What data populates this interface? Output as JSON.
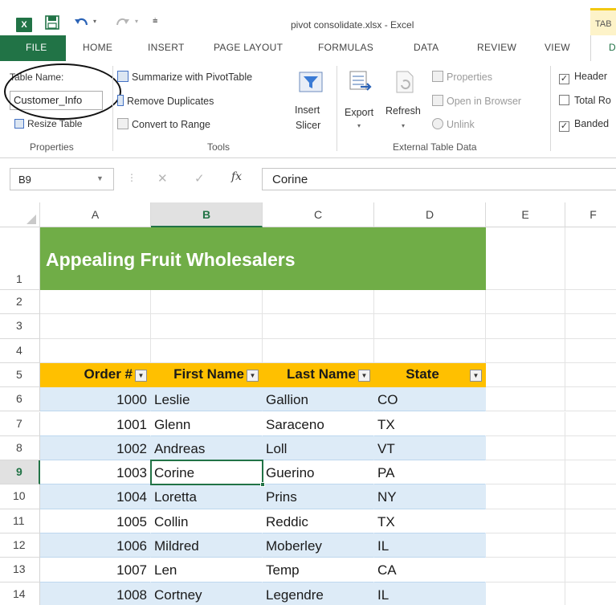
{
  "window": {
    "title": "pivot consolidate.xlsx - Excel",
    "context_tab_group": "TAB",
    "app_icon": "excel-logo"
  },
  "qat": {
    "save_icon": "save-icon",
    "undo_icon": "undo-icon",
    "redo_icon": "redo-icon",
    "customize_icon": "customize-qat-icon"
  },
  "tabs": {
    "file": "FILE",
    "home": "HOME",
    "insert": "INSERT",
    "page_layout": "PAGE LAYOUT",
    "formulas": "FORMULAS",
    "data": "DATA",
    "review": "REVIEW",
    "view": "VIEW",
    "design": "D"
  },
  "ribbon": {
    "properties": {
      "table_name_label": "Table Name:",
      "table_name_value": "Customer_Info",
      "resize_table": "Resize Table",
      "group_label": "Properties"
    },
    "tools": {
      "summarize_pivot": "Summarize with PivotTable",
      "remove_duplicates": "Remove Duplicates",
      "convert_to_range": "Convert to Range",
      "insert_slicer_line1": "Insert",
      "insert_slicer_line2": "Slicer",
      "group_label": "Tools"
    },
    "external": {
      "export": "Export",
      "refresh": "Refresh",
      "properties": "Properties",
      "open_in_browser": "Open in Browser",
      "unlink": "Unlink",
      "group_label": "External Table Data"
    },
    "style_options": {
      "header_row": "Header",
      "header_row_checked": true,
      "total_row": "Total Ro",
      "total_row_checked": false,
      "banded_rows": "Banded",
      "banded_rows_checked": true
    }
  },
  "formula_bar": {
    "name_box": "B9",
    "cancel_icon": "✕",
    "enter_icon": "✓",
    "fx_label": "fx",
    "content": "Corine"
  },
  "grid": {
    "column_headers": [
      "A",
      "B",
      "C",
      "D",
      "E",
      "F"
    ],
    "selected_column": "B",
    "row_headers": [
      "1",
      "2",
      "3",
      "4",
      "5",
      "6",
      "7",
      "8",
      "9",
      "10",
      "11",
      "12",
      "13",
      "14"
    ],
    "selected_row": "9",
    "sheet_title": "Appealing Fruit Wholesalers",
    "table_headers": [
      "Order #",
      "First Name",
      "Last Name",
      "State"
    ],
    "rows": [
      [
        "1000",
        "Leslie",
        "Gallion",
        "CO"
      ],
      [
        "1001",
        "Glenn",
        "Saraceno",
        "TX"
      ],
      [
        "1002",
        "Andreas",
        "Loll",
        "VT"
      ],
      [
        "1003",
        "Corine",
        "Guerino",
        "PA"
      ],
      [
        "1004",
        "Loretta",
        "Prins",
        "NY"
      ],
      [
        "1005",
        "Collin",
        "Reddic",
        "TX"
      ],
      [
        "1006",
        "Mildred",
        "Moberley",
        "IL"
      ],
      [
        "1007",
        "Len",
        "Temp",
        "CA"
      ],
      [
        "1008",
        "Cortney",
        "Legendre",
        "IL"
      ]
    ]
  },
  "colors": {
    "excel_green": "#217346",
    "title_band": "#70ad47",
    "header_band": "#ffc000",
    "row_band": "#ddebf7"
  }
}
